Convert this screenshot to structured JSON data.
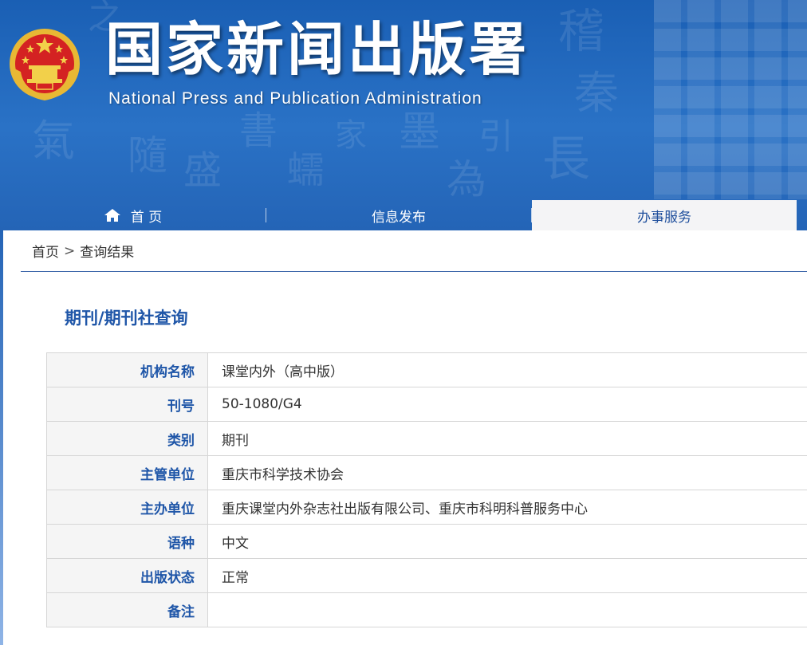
{
  "header": {
    "title": "国家新闻出版署",
    "subtitle": "National  Press and Publication Administration"
  },
  "nav": {
    "items": [
      {
        "label": "首 页",
        "icon": "home-icon"
      },
      {
        "label": "信息发布"
      },
      {
        "label": "办事服务",
        "active": true
      }
    ]
  },
  "breadcrumb": {
    "home": "首页",
    "separator": ">",
    "current": "查询结果"
  },
  "section": {
    "title": "期刊/期刊社查询"
  },
  "table": {
    "rows": [
      {
        "label": "机构名称",
        "value": "课堂内外（高中版）"
      },
      {
        "label": "刊号",
        "value": "50-1080/G4"
      },
      {
        "label": "类别",
        "value": "期刊"
      },
      {
        "label": "主管单位",
        "value": "重庆市科学技术协会"
      },
      {
        "label": "主办单位",
        "value": "重庆课堂内外杂志社出版有限公司、重庆市科明科普服务中心"
      },
      {
        "label": "语种",
        "value": "中文"
      },
      {
        "label": "出版状态",
        "value": "正常"
      },
      {
        "label": "备注",
        "value": ""
      }
    ]
  },
  "colors": {
    "header_blue": "#1a5fb4",
    "label_blue": "#1f56a8",
    "active_tab_bg": "#f4f4f6"
  }
}
